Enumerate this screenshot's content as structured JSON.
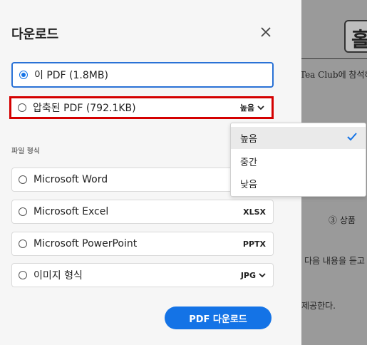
{
  "panel": {
    "title": "다운로드",
    "section_label": "파일 형식",
    "download_button": "PDF 다운로드"
  },
  "options": {
    "pdf": {
      "label": "이 PDF (1.8MB)",
      "selected": true
    },
    "compressed": {
      "label": "압축된 PDF (792.1KB)",
      "quality": "높음"
    },
    "word": {
      "label": "Microsoft Word",
      "format": ""
    },
    "excel": {
      "label": "Microsoft Excel",
      "format": "XLSX"
    },
    "powerpoint": {
      "label": "Microsoft PowerPoint",
      "format": "PPTX"
    },
    "image": {
      "label": "이미지 형식",
      "format": "JPG"
    }
  },
  "dropdown": {
    "items": [
      {
        "label": "높음",
        "checked": true
      },
      {
        "label": "중간",
        "checked": false
      },
      {
        "label": "낮음",
        "checked": false
      }
    ]
  },
  "background_doc": {
    "heading": "홀",
    "line1": "Tea Club에 참석하",
    "line2": "③ 상품",
    "line3": "다음 내용을 듣고",
    "line4": "제공한다."
  },
  "colors": {
    "accent": "#1473e6",
    "highlight": "#d40000",
    "panel_bg": "#f6f6f6"
  },
  "icons": {
    "close": "close-icon",
    "chevron": "chevron-down-icon",
    "check": "checkmark-icon"
  }
}
